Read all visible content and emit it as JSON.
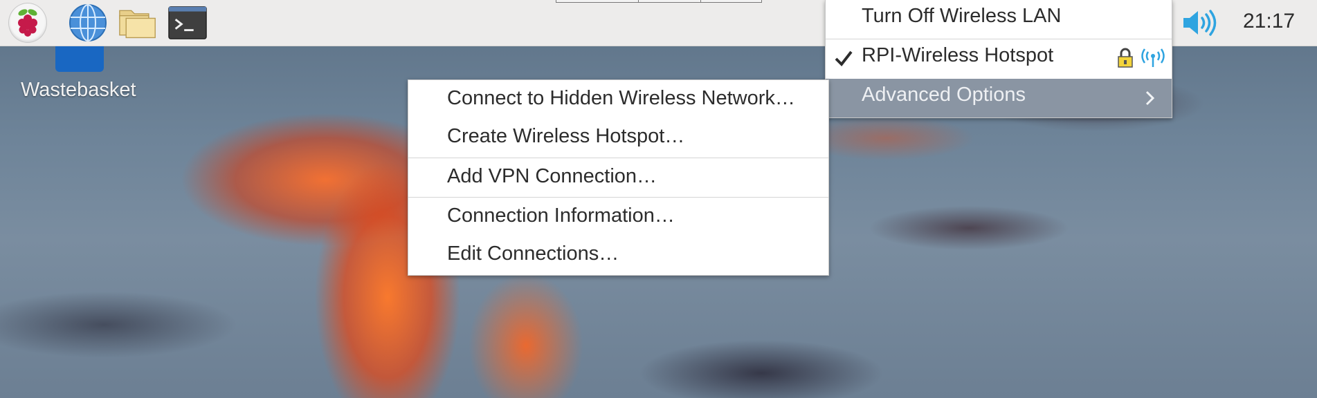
{
  "colors": {
    "taskbar_bg": "#edeceb",
    "menu_bg": "#ffffff",
    "highlight_bg": "#8a95a3",
    "accent_blue": "#2fa4e0",
    "lock_yellow": "#f3d43a"
  },
  "taskbar": {
    "launchers": [
      "raspberry-menu-icon",
      "web-browser-icon",
      "file-manager-icon",
      "terminal-icon"
    ],
    "clock": "21:17",
    "volume_icon": "speaker-volume-icon"
  },
  "desktop": {
    "icons": [
      {
        "label": "Wastebasket",
        "icon": "wastebasket-icon"
      }
    ]
  },
  "network_menu": {
    "items": [
      {
        "label": "Turn Off Wireless LAN"
      },
      {
        "label": "RPI-Wireless Hotspot",
        "checked": true,
        "secured": true,
        "icon": "wifi-signal-icon"
      },
      {
        "label": "Advanced Options",
        "submenu": true,
        "highlighted": true
      }
    ]
  },
  "advanced_menu": {
    "items": [
      {
        "label": "Connect to Hidden Wireless Network…",
        "mnemonic": "C"
      },
      {
        "label": "Create Wireless Hotspot…",
        "mnemonic": "H"
      },
      {
        "label": "Add VPN Connection…",
        "mnemonic": "A"
      },
      {
        "label": "Connection Information…",
        "mnemonic": "I"
      },
      {
        "label": "Edit Connections…"
      }
    ]
  }
}
